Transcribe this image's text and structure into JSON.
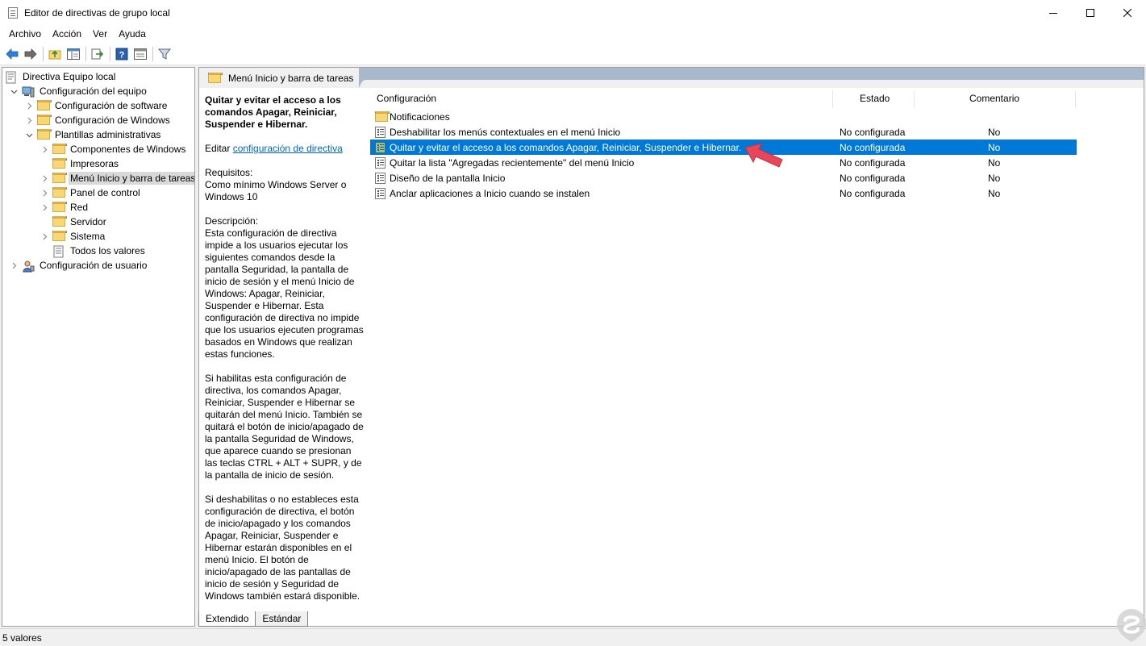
{
  "window": {
    "title": "Editor de directivas de grupo local",
    "minimize_icon": "minimize-icon",
    "maximize_icon": "maximize-icon",
    "close_icon": "close-icon"
  },
  "menu": [
    "Archivo",
    "Acción",
    "Ver",
    "Ayuda"
  ],
  "toolbar": {
    "buttons": [
      "back-arrow-icon",
      "forward-arrow-icon",
      "up-folder-icon",
      "show-hide-tree-icon",
      "export-list-icon",
      "help-icon",
      "properties-icon",
      "filter-icon"
    ]
  },
  "tree": [
    {
      "label": "Directiva Equipo local",
      "icon": "policy-document-icon",
      "level": 0,
      "expander": "none"
    },
    {
      "label": "Configuración del equipo",
      "icon": "computer-icon",
      "level": 1,
      "expander": "expanded"
    },
    {
      "label": "Configuración de software",
      "icon": "folder-icon",
      "level": 2,
      "expander": "collapsed"
    },
    {
      "label": "Configuración de Windows",
      "icon": "folder-icon",
      "level": 2,
      "expander": "collapsed"
    },
    {
      "label": "Plantillas administrativas",
      "icon": "folder-icon",
      "level": 2,
      "expander": "expanded"
    },
    {
      "label": "Componentes de Windows",
      "icon": "folder-icon",
      "level": 3,
      "expander": "collapsed"
    },
    {
      "label": "Impresoras",
      "icon": "folder-icon",
      "level": 3,
      "expander": "none"
    },
    {
      "label": "Menú Inicio y barra de tareas",
      "icon": "folder-icon",
      "level": 3,
      "expander": "collapsed",
      "selected": true
    },
    {
      "label": "Panel de control",
      "icon": "folder-icon",
      "level": 3,
      "expander": "collapsed"
    },
    {
      "label": "Red",
      "icon": "folder-icon",
      "level": 3,
      "expander": "collapsed"
    },
    {
      "label": "Servidor",
      "icon": "folder-icon",
      "level": 3,
      "expander": "none"
    },
    {
      "label": "Sistema",
      "icon": "folder-icon",
      "level": 3,
      "expander": "collapsed"
    },
    {
      "label": "Todos los valores",
      "icon": "all-settings-icon",
      "level": 3,
      "expander": "none"
    },
    {
      "label": "Configuración de usuario",
      "icon": "user-icon",
      "level": 1,
      "expander": "collapsed"
    }
  ],
  "right_header": {
    "title": "Menú Inicio y barra de tareas"
  },
  "description": {
    "title": "Quitar y evitar el acceso a los comandos Apagar, Reiniciar, Suspender e Hibernar.",
    "edit_prefix": "Editar ",
    "edit_link": "configuración de directiva",
    "requirements_label": "Requisitos:",
    "requirements_text": "Como mínimo Windows Server o Windows 10",
    "description_label": "Descripción:",
    "paragraph1": "Esta configuración de directiva impide a los usuarios ejecutar los siguientes comandos desde la pantalla Seguridad, la pantalla de inicio de sesión y el menú Inicio de Windows: Apagar, Reiniciar, Suspender e Hibernar. Esta configuración de directiva no impide que los usuarios ejecuten programas basados en Windows que realizan estas funciones.",
    "paragraph2": "Si habilitas esta configuración de directiva, los comandos Apagar, Reiniciar, Suspender e Hibernar se quitarán del menú Inicio. También se quitará el botón de inicio/apagado de la pantalla Seguridad de Windows, que aparece cuando se presionan las teclas CTRL + ALT + SUPR, y de la pantalla de inicio de sesión.",
    "paragraph3": "Si deshabilitas o no estableces esta configuración de directiva, el botón de inicio/apagado y los comandos Apagar, Reiniciar, Suspender e Hibernar estarán disponibles en el menú Inicio. El botón de inicio/apagado de las pantallas de inicio de sesión y Seguridad de Windows también estará disponible."
  },
  "list": {
    "columns": [
      "Configuración",
      "Estado",
      "Comentario"
    ],
    "rows": [
      {
        "name": "Notificaciones",
        "state": "",
        "comment": "",
        "type": "folder"
      },
      {
        "name": "Deshabilitar los menús contextuales en el menú Inicio",
        "state": "No configurada",
        "comment": "No",
        "type": "setting"
      },
      {
        "name": "Quitar y evitar el acceso a los comandos Apagar, Reiniciar, Suspender e Hibernar.",
        "state": "No configurada",
        "comment": "No",
        "type": "setting",
        "selected": true
      },
      {
        "name": "Quitar la lista \"Agregadas recientemente\" del menú Inicio",
        "state": "No configurada",
        "comment": "No",
        "type": "setting"
      },
      {
        "name": "Diseño de la pantalla Inicio",
        "state": "No configurada",
        "comment": "No",
        "type": "setting"
      },
      {
        "name": "Anclar aplicaciones a Inicio cuando se instalen",
        "state": "No configurada",
        "comment": "No",
        "type": "setting"
      }
    ]
  },
  "tabs": [
    "Extendido",
    "Estándar"
  ],
  "status": "5 valores",
  "colors": {
    "selection": "#0078d7",
    "annotation_arrow": "#e8465a",
    "link": "#0066cc"
  }
}
